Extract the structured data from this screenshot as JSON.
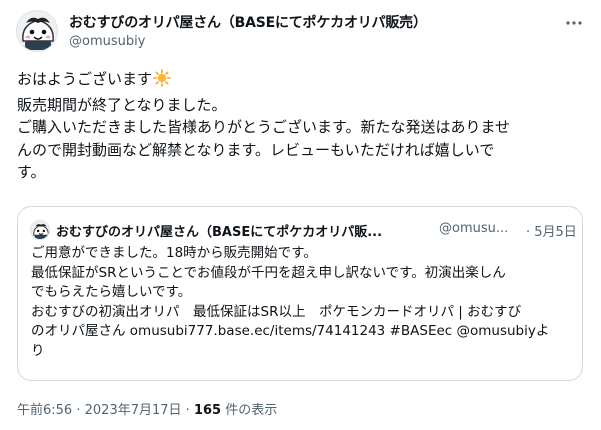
{
  "tweet": {
    "author": {
      "display_name": "おむすびのオリパ屋さん（BASEにてポケカオリパ販売）",
      "handle": "@omusubiy",
      "avatar_icon": "cartoon-onigiri-avatar"
    },
    "more_icon": "more-options-icon",
    "body_lines": [
      "おはようございます",
      "販売期間が終了となりました。",
      "ご購入いただきました皆様ありがとうございます。新たな発送はありませ",
      "んので開封動画など解禁となります。レビューもいただければ嬉しいで",
      "す。"
    ],
    "emoji": "sun-emoji",
    "quote": {
      "display_name": "おむすびのオリパ屋さん（BASEにてポケカオリパ販...",
      "handle": "@omusu...",
      "date": "· 5月5日",
      "body_lines": [
        "ご用意ができました。18時から販売開始です。",
        "最低保証がSRということでお値段が千円を超え申し訳ないです。初演出楽しん",
        "でもらえたら嬉しいです。",
        "おむすびの初演出オリパ　最低保証はSR以上　ポケモンカードオリパ | おむすび",
        "のオリパ屋さん omusubi777.base.ec/items/74141243 #BASEec @omusubiyよ",
        "り"
      ]
    },
    "meta": {
      "time": "午前6:56",
      "separator": "·",
      "date": "2023年7月17日",
      "views_count": "165",
      "views_label": "件の表示"
    }
  }
}
